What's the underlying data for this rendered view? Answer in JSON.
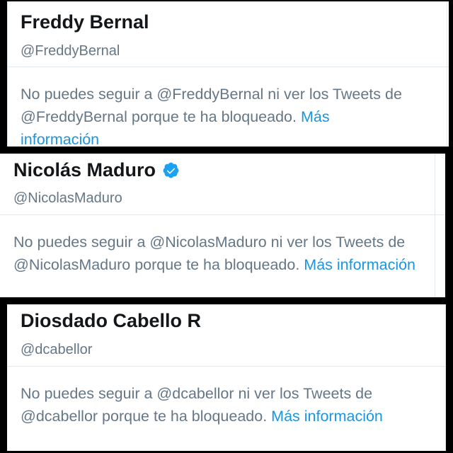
{
  "blocks": [
    {
      "name": "Freddy Bernal",
      "handle": "@FreddyBernal",
      "verified": false,
      "message": "No puedes seguir a @FreddyBernal ni ver los Tweets de @FreddyBernal porque te ha bloqueado.",
      "link": "Más información"
    },
    {
      "name": "Nicolás Maduro",
      "handle": "@NicolasMaduro",
      "verified": true,
      "message": "No puedes seguir a @NicolasMaduro ni ver los Tweets de @NicolasMaduro porque te ha bloqueado.",
      "link": "Más información"
    },
    {
      "name": "Diosdado Cabello R",
      "handle": "@dcabellor",
      "verified": false,
      "message": "No puedes seguir a @dcabellor ni ver los Tweets de @dcabellor porque te ha bloqueado.",
      "link": "Más información"
    }
  ],
  "colors": {
    "background": "#000000",
    "card": "#ffffff",
    "name": "#14171a",
    "secondary_text": "#657786",
    "link": "#1b95e0",
    "verified_badge": "#1da1f2",
    "divider": "#e1e8ed"
  }
}
